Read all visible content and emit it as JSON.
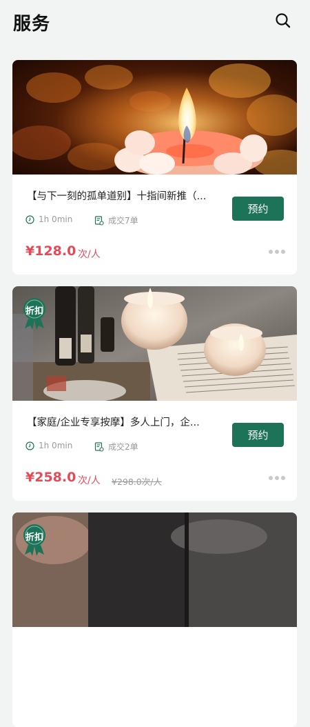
{
  "header": {
    "title": "服务",
    "search_icon": "search-icon"
  },
  "colors": {
    "accent": "#1d7357",
    "price": "#e54a57",
    "muted": "#9a9a9a",
    "background": "#f2f3f3"
  },
  "services": [
    {
      "title": "【与下一刻的孤单道别】十指间新推（...",
      "duration": "1h 0min",
      "deals": "成交7单",
      "book_label": "预约",
      "price": "¥128.0",
      "unit": "次/人",
      "original_price": "",
      "badge": ""
    },
    {
      "title": "【家庭/企业专享按摩】多人上门，企...",
      "duration": "1h 0min",
      "deals": "成交2单",
      "book_label": "预约",
      "price": "¥258.0",
      "unit": "次/人",
      "original_price": "¥298.0次/人",
      "badge": "折扣"
    },
    {
      "badge": "折扣"
    }
  ]
}
